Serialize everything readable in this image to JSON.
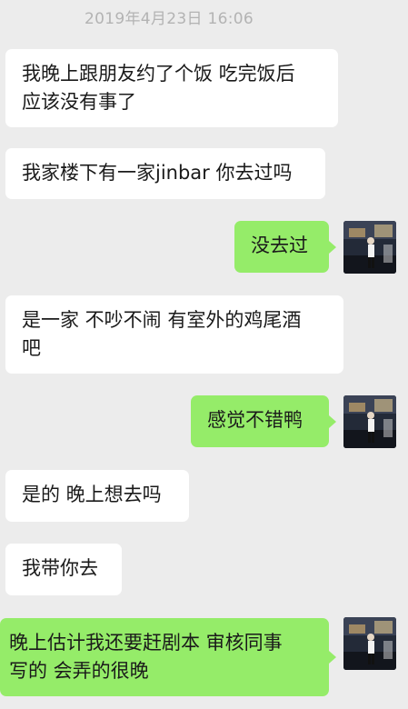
{
  "chat": {
    "timestamp": "2019年4月23日 16:06",
    "messages": [
      {
        "side": "incoming",
        "text": "我晚上跟朋友约了个饭 吃完饭后\n应该没有事了"
      },
      {
        "side": "incoming",
        "text": "我家楼下有一家jinbar 你去过吗"
      },
      {
        "side": "outgoing",
        "text": "没去过"
      },
      {
        "side": "incoming",
        "text": "是一家 不吵不闹 有室外的鸡尾酒\n吧"
      },
      {
        "side": "outgoing",
        "text": "感觉不错鸭"
      },
      {
        "side": "incoming",
        "text": "是的 晚上想去吗"
      },
      {
        "side": "incoming",
        "text": "我带你去"
      },
      {
        "side": "outgoing",
        "text": "晚上估计我还要赶剧本 审核同事\n写的 会弄的很晚"
      }
    ]
  },
  "colors": {
    "background": "#ececec",
    "incoming_bubble": "#ffffff",
    "outgoing_bubble": "#95ec69",
    "timestamp_text": "#b3b3b3"
  },
  "icons": {
    "avatar": "user-avatar-photo"
  }
}
